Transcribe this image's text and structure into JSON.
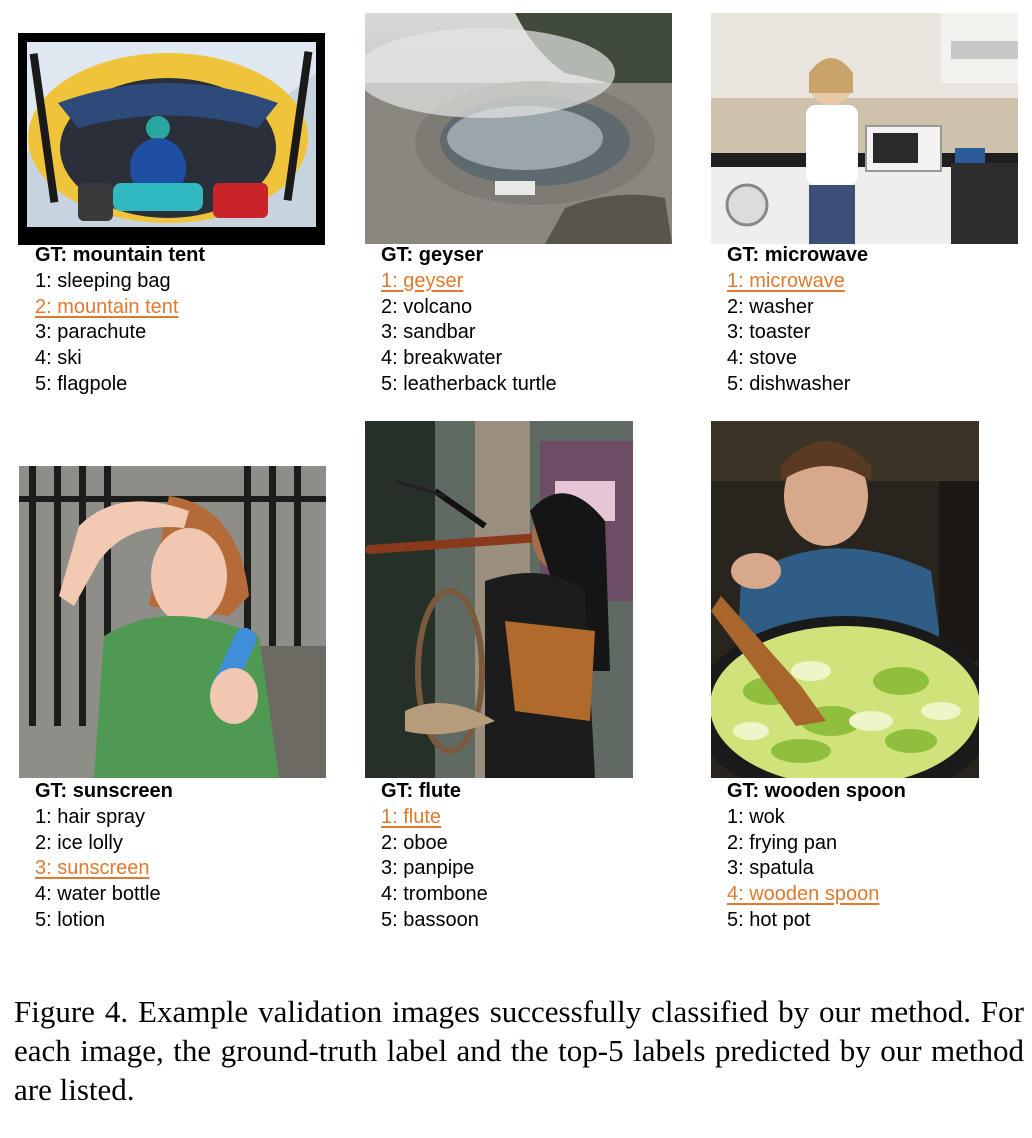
{
  "figure": {
    "caption": "Figure 4. Example validation images successfully classified by our method. For each image, the ground-truth label and the top-5 labels predicted by our method are listed.",
    "accent_color": "#e07a2e",
    "examples": [
      {
        "gt": "GT: mountain tent",
        "preds": [
          "1: sleeping bag",
          "2: mountain tent",
          "3: parachute",
          "4: ski",
          "5: flagpole"
        ],
        "hit_index": 1,
        "image": "tent-photo"
      },
      {
        "gt": "GT: geyser",
        "preds": [
          "1: geyser",
          "2: volcano",
          "3: sandbar",
          "4: breakwater",
          "5: leatherback turtle"
        ],
        "hit_index": 0,
        "image": "geyser-photo"
      },
      {
        "gt": "GT: microwave",
        "preds": [
          "1: microwave",
          "2: washer",
          "3: toaster",
          "4: stove",
          "5: dishwasher"
        ],
        "hit_index": 0,
        "image": "kitchen-photo"
      },
      {
        "gt": "GT: sunscreen",
        "preds": [
          "1: hair spray",
          "2: ice lolly",
          "3: sunscreen",
          "4: water bottle",
          "5: lotion"
        ],
        "hit_index": 2,
        "image": "sunscreen-photo"
      },
      {
        "gt": "GT: flute",
        "preds": [
          "1: flute",
          "2: oboe",
          "3: panpipe",
          "4: trombone",
          "5: bassoon"
        ],
        "hit_index": 0,
        "image": "flute-photo"
      },
      {
        "gt": "GT: wooden spoon",
        "preds": [
          "1: wok",
          "2: frying pan",
          "3: spatula",
          "4: wooden spoon",
          "5: hot pot"
        ],
        "hit_index": 3,
        "image": "wok-photo"
      }
    ]
  }
}
